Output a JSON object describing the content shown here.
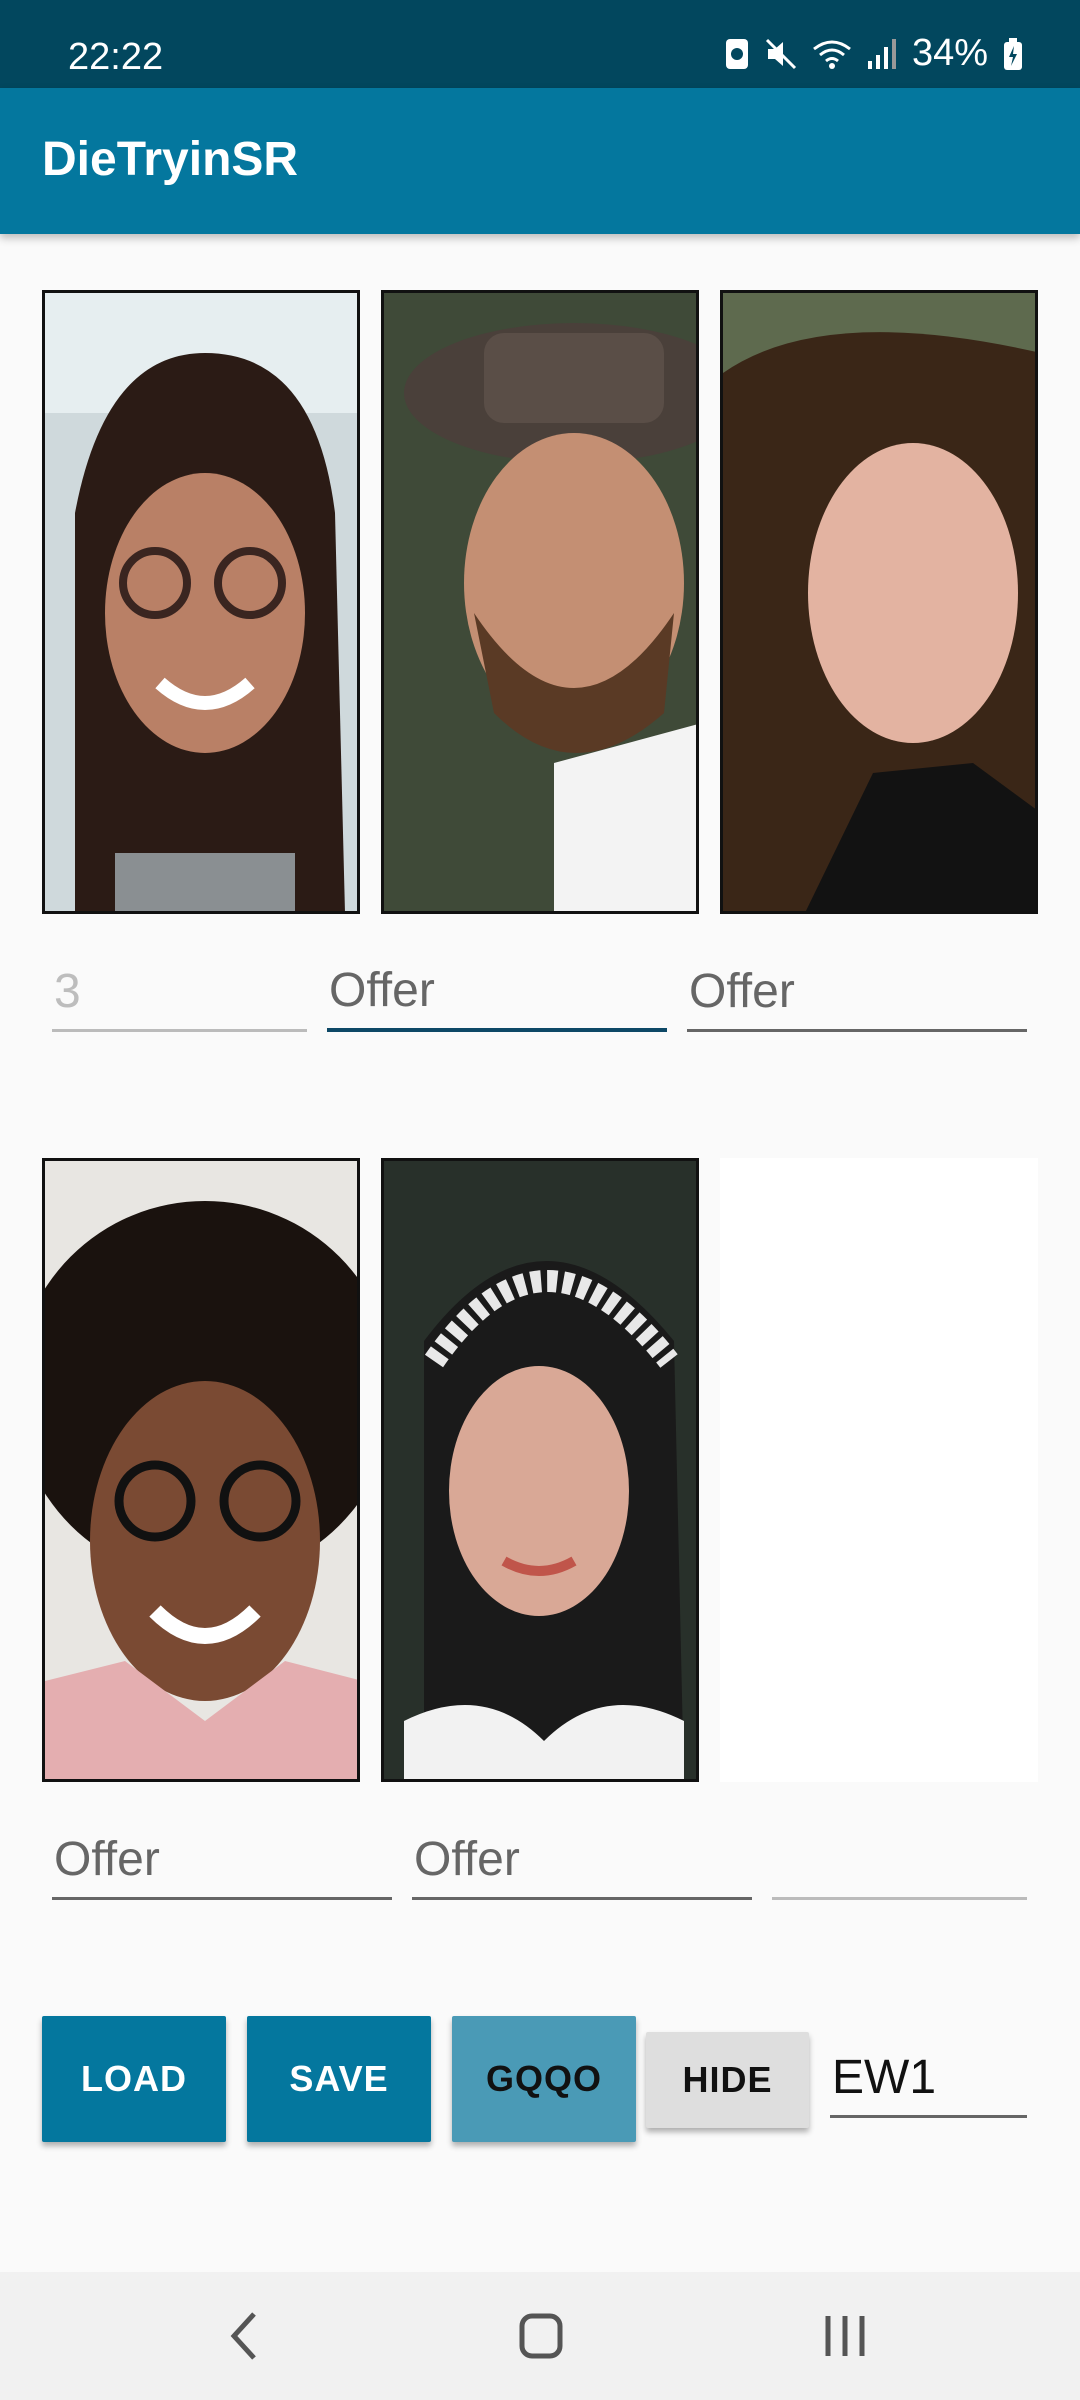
{
  "status": {
    "time": "22:22",
    "battery": "34%"
  },
  "app": {
    "title": "DieTryinSR"
  },
  "row1": {
    "photos": [
      {
        "alt": "woman with glasses"
      },
      {
        "alt": "man with hat"
      },
      {
        "alt": "woman with curly hair"
      }
    ],
    "fields": [
      {
        "value": "3",
        "state": "disabled"
      },
      {
        "value": "Offer",
        "state": "focused"
      },
      {
        "value": "Offer",
        "state": "normal"
      }
    ]
  },
  "row2": {
    "photos": [
      {
        "alt": "smiling woman with glasses"
      },
      {
        "alt": "woman with patterned headscarf"
      },
      {
        "alt": "empty slot"
      }
    ],
    "fields": [
      {
        "value": "Offer"
      },
      {
        "value": "Offer"
      },
      {
        "value": ""
      }
    ]
  },
  "buttons": {
    "load": "LOAD",
    "save": "SAVE",
    "gqqo": "GQQO",
    "hide": "HIDE"
  },
  "code_field": {
    "value": "EW1"
  },
  "colors": {
    "statusbar": "#02475e",
    "appbar": "#04779e",
    "accent_light": "#4a9ab6"
  },
  "nav": {
    "icons": [
      "back-icon",
      "home-icon",
      "recents-icon"
    ]
  }
}
